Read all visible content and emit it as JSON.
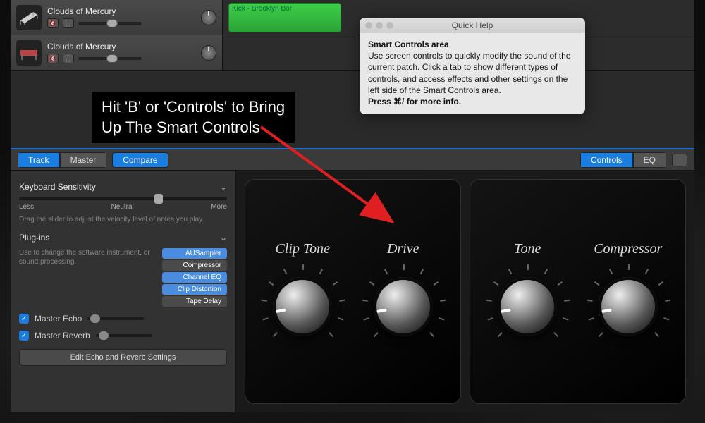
{
  "tracks": [
    {
      "name": "Clouds of Mercury",
      "has_region": true,
      "region_label": "Kick - Brooklyn Bor"
    },
    {
      "name": "Clouds of Mercury",
      "has_region": false
    }
  ],
  "annotation": {
    "line1": "Hit 'B' or 'Controls' to Bring",
    "line2": "Up The Smart Controls"
  },
  "quick_help": {
    "title": "Quick Help",
    "heading": "Smart Controls area",
    "body": "Use screen controls to quickly modify the sound of the current patch. Click a tab to show different types of controls, and access effects and other settings on the left side of the Smart Controls area.",
    "footer": "Press ⌘/ for more info."
  },
  "smart_bar": {
    "left_seg": [
      "Track",
      "Master"
    ],
    "left_active": 0,
    "compare": "Compare",
    "right_seg": [
      "Controls",
      "EQ"
    ],
    "right_active": 0
  },
  "inspector": {
    "keyboard_sensitivity": {
      "title": "Keyboard Sensitivity",
      "labels": {
        "less": "Less",
        "neutral": "Neutral",
        "more": "More"
      },
      "desc": "Drag the slider to adjust the velocity level of notes you play."
    },
    "plugins": {
      "title": "Plug-ins",
      "desc": "Use to change the software instrument, or sound processing.",
      "list": [
        {
          "name": "AUSampler",
          "dark": false
        },
        {
          "name": "Compressor",
          "dark": true
        },
        {
          "name": "Channel EQ",
          "dark": false
        },
        {
          "name": "Clip Distortion",
          "dark": false
        },
        {
          "name": "Tape Delay",
          "dark": true
        }
      ]
    },
    "master_echo": "Master Echo",
    "master_reverb": "Master Reverb",
    "edit_button": "Edit Echo and Reverb Settings"
  },
  "knobs": {
    "panel1": [
      "Clip Tone",
      "Drive"
    ],
    "panel2": [
      "Tone",
      "Compressor"
    ]
  }
}
